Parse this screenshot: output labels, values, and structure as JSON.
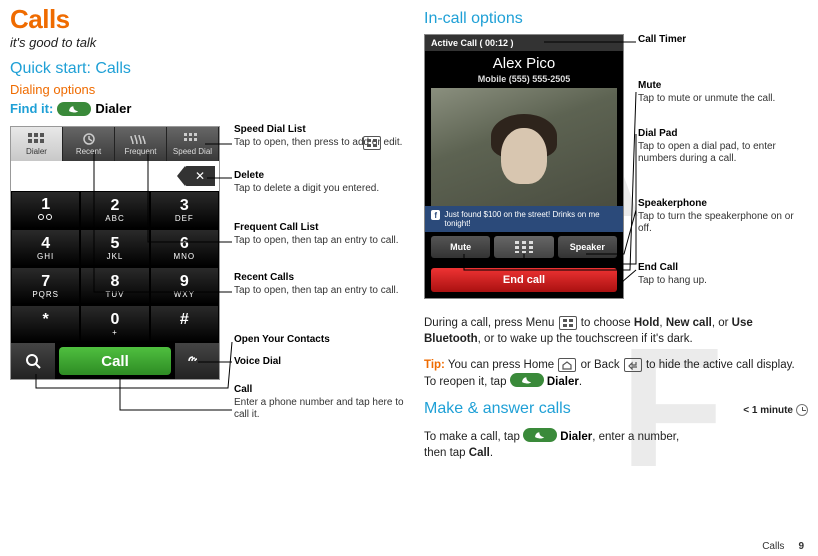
{
  "page": {
    "footer_label": "Calls",
    "page_number": "9"
  },
  "left": {
    "title": "Calls",
    "subtitle": "it's good to talk",
    "quickstart": "Quick start: Calls",
    "dialing_options": "Dialing options",
    "find_it": "Find it:",
    "find_it_label": "Dialer",
    "tabs": {
      "dialer": "Dialer",
      "recent": "Recent",
      "frequent": "Frequent",
      "speeddial": "Speed Dial"
    },
    "keys": {
      "1n": "1",
      "1l": "",
      "2n": "2",
      "2l": "ABC",
      "3n": "3",
      "3l": "DEF",
      "4n": "4",
      "4l": "GHI",
      "5n": "5",
      "5l": "JKL",
      "6n": "6",
      "6l": "MNO",
      "7n": "7",
      "7l": "PQRS",
      "8n": "8",
      "8l": "TUV",
      "9n": "9",
      "9l": "WXY",
      "star": "*",
      "0n": "0",
      "0l": "+",
      "hash": "#"
    },
    "call_btn": "Call",
    "callouts": {
      "speeddial_t": "Speed Dial List",
      "speeddial_b": "Tap to open, then press       to add or edit.",
      "delete_t": "Delete",
      "delete_b": "Tap to delete a digit you entered.",
      "frequent_t": "Frequent Call List",
      "frequent_b": "Tap to open, then tap an entry to call.",
      "recent_t": "Recent Calls",
      "recent_b": "Tap to open, then tap an entry to call.",
      "contacts_t": "Open Your Contacts",
      "voicedial_t": "Voice Dial",
      "call_t": "Call",
      "call_b": "Enter a phone number and tap here to call it."
    }
  },
  "right": {
    "incall_options": "In-call options",
    "active_call": "Active Call ( 00:12 )",
    "name": "Alex Pico",
    "number": "Mobile (555) 555-2505",
    "social": "Just found $100 on the street! Drinks on me tonight!",
    "mute_btn": "Mute",
    "speaker_btn": "Speaker",
    "endcall_btn": "End call",
    "callouts": {
      "timer_t": "Call Timer",
      "mute_t": "Mute",
      "mute_b": "Tap to mute or unmute the call.",
      "dialpad_t": "Dial Pad",
      "dialpad_b": "Tap to open a dial pad, to enter numbers during a call.",
      "speaker_t": "Speakerphone",
      "speaker_b": "Tap to turn the speakerphone on or off.",
      "endcall_t": "End Call",
      "endcall_b": "Tap to hang up."
    },
    "para1_a": "During a call, press Menu ",
    "para1_b": " to choose ",
    "hold": "Hold",
    "comma1": ", ",
    "newcall": "New call",
    "comma2": ", or ",
    "usebt": "Use Bluetooth",
    "para1_c": ", or to wake up the touchscreen if it's dark.",
    "tip_label": "Tip:",
    "tip_a": " You can press Home ",
    "tip_b": " or Back ",
    "tip_c": " to hide the active call display. To reopen it, tap ",
    "tip_d": "Dialer",
    "tip_e": ".",
    "make_answer": "Make & answer calls",
    "minute": "< 1 minute",
    "para2_a": "To make a call, tap ",
    "para2_b": "Dialer",
    "para2_c": ", enter a number, then tap ",
    "para2_d": "Call",
    "para2_e": "."
  }
}
